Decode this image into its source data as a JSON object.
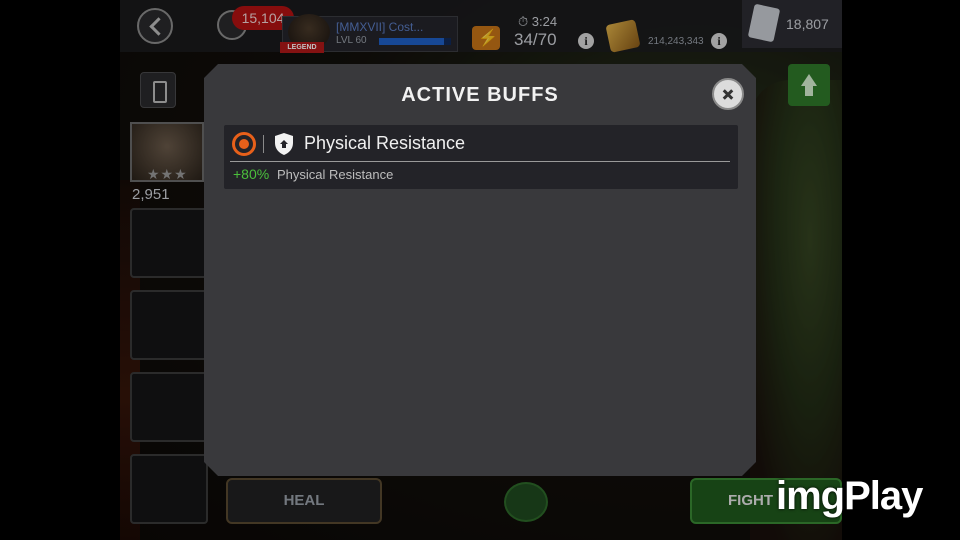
{
  "header": {
    "notification_count": "15,104",
    "player": {
      "name": "[MMXVII] Cost...",
      "level": "LVL 60",
      "legend_tag": "LEGEND",
      "xp_fraction": 0.9
    },
    "energy": {
      "timer": "3:24",
      "count": "34/70"
    },
    "gold": "214,243,343",
    "units": "18,807",
    "info_glyph": "i"
  },
  "champion": {
    "stars": "★★★",
    "rating": "2,951"
  },
  "bottom": {
    "heal_label": "HEAL",
    "fight_label": "FIGHT"
  },
  "modal": {
    "title": "ACTIVE BUFFS",
    "buffs": [
      {
        "name": "Physical Resistance",
        "value": "+80%",
        "description": "Physical Resistance",
        "icon": "physical-resistance-shield-icon",
        "type_icon": "buff-type-icon"
      }
    ]
  },
  "watermark": "imgPlay",
  "colors": {
    "buff_value": "#4bbf3c",
    "buff_type": "#e8601a",
    "fight": "#1f5a1d",
    "notification": "#b31212"
  }
}
